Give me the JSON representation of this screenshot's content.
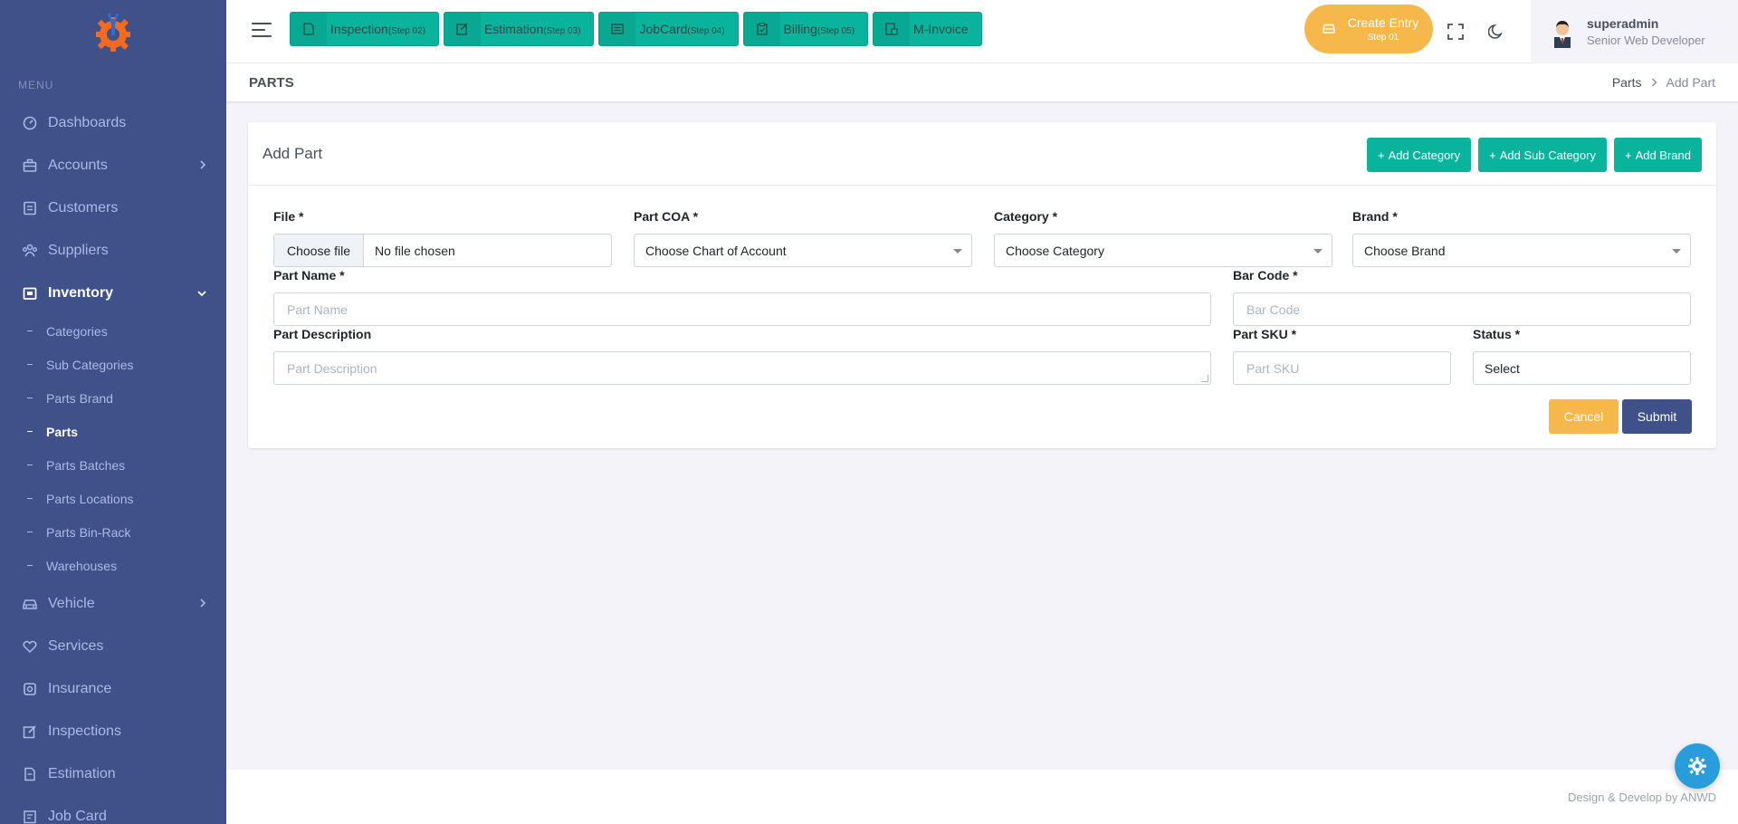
{
  "sidebar": {
    "menu_title": "MENU",
    "items": [
      {
        "label": "Dashboards",
        "icon": "dashboard-icon"
      },
      {
        "label": "Accounts",
        "icon": "briefcase-icon"
      },
      {
        "label": "Customers",
        "icon": "contacts-icon"
      },
      {
        "label": "Suppliers",
        "icon": "users-icon"
      },
      {
        "label": "Inventory",
        "icon": "inventory-icon"
      },
      {
        "label": "Vehicle",
        "icon": "car-icon"
      },
      {
        "label": "Services",
        "icon": "heart-icon"
      },
      {
        "label": "Insurance",
        "icon": "insurance-icon"
      },
      {
        "label": "Inspections",
        "icon": "edit-icon"
      },
      {
        "label": "Estimation",
        "icon": "file-icon"
      },
      {
        "label": "Job Card",
        "icon": "jobcard-icon"
      }
    ],
    "inventory_sub": [
      "Categories",
      "Sub Categories",
      "Parts Brand",
      "Parts",
      "Parts Batches",
      "Parts Locations",
      "Parts Bin-Rack",
      "Warehouses"
    ]
  },
  "topbar": {
    "steps": [
      {
        "label": "Inspection",
        "step": "(Step 02)"
      },
      {
        "label": "Estimation",
        "step": "(Step 03)"
      },
      {
        "label": "JobCard",
        "step": "(Step 04)"
      },
      {
        "label": "Billing",
        "step": "(Step 05)"
      },
      {
        "label": "M-Invoice",
        "step": ""
      }
    ],
    "create_entry": {
      "title": "Create Entry",
      "sub": "Step 01"
    },
    "user": {
      "name": "superadmin",
      "role": "Senior Web Developer"
    }
  },
  "page": {
    "title": "PARTS",
    "breadcrumb": {
      "parent": "Parts",
      "current": "Add Part"
    }
  },
  "card": {
    "title": "Add Part",
    "buttons": {
      "add_category": "Add Category",
      "add_sub_category": "Add Sub Category",
      "add_brand": "Add Brand"
    }
  },
  "form": {
    "file": {
      "label": "File *",
      "button": "Choose file",
      "value": "No file chosen"
    },
    "part_coa": {
      "label": "Part COA *",
      "value": "Choose Chart of Account"
    },
    "category": {
      "label": "Category *",
      "value": "Choose Category"
    },
    "brand": {
      "label": "Brand *",
      "value": "Choose Brand"
    },
    "part_name": {
      "label": "Part Name *",
      "placeholder": "Part Name"
    },
    "bar_code": {
      "label": "Bar Code *",
      "placeholder": "Bar Code"
    },
    "part_description": {
      "label": "Part Description",
      "placeholder": "Part Description"
    },
    "part_sku": {
      "label": "Part SKU *",
      "placeholder": "Part SKU"
    },
    "status": {
      "label": "Status *",
      "value": "Select"
    },
    "cancel": "Cancel",
    "submit": "Submit"
  },
  "footer": {
    "text": "Design & Develop by ANWD"
  },
  "colors": {
    "sidebar": "#405189",
    "primary_green": "#0ab39c",
    "warning": "#f7b84b",
    "submit": "#405189",
    "fab": "#299cdb"
  }
}
